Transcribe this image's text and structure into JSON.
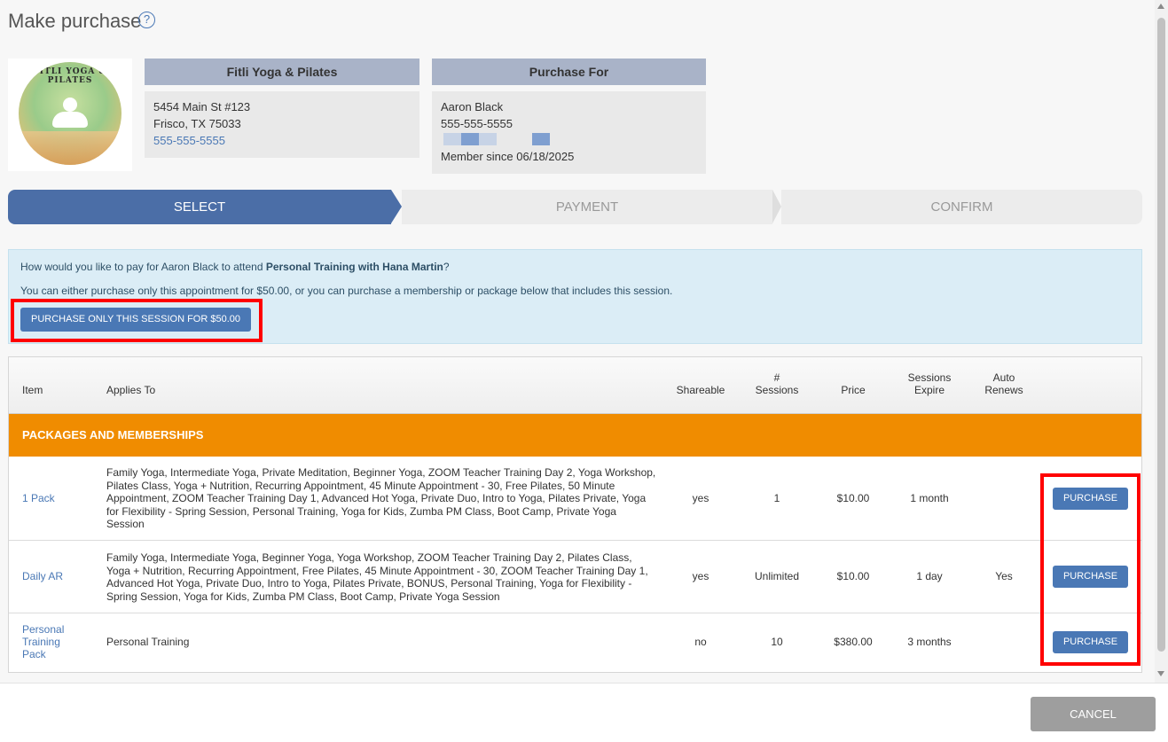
{
  "dialog": {
    "title": "Make purchase",
    "help_icon": "question-circle-icon"
  },
  "studio": {
    "name": "Fitli Yoga & Pilates",
    "logo_text": "FITLI YOGA & PILATES",
    "address_line1": "5454 Main St #123",
    "address_line2": "Frisco, TX 75033",
    "phone": "555-555-5555"
  },
  "purchase_for": {
    "heading": "Purchase For",
    "name": "Aaron Black",
    "phone": "555-555-5555",
    "member_since": "Member since 06/18/2025"
  },
  "steps": [
    "SELECT",
    "PAYMENT",
    "CONFIRM"
  ],
  "active_step": "SELECT",
  "info": {
    "line1_prefix": "How would you like to pay for Aaron Black to attend ",
    "line1_bold": "Personal Training with Hana Martin",
    "line1_suffix": "?",
    "line2": "You can either purchase only this appointment for $50.00, or you can purchase a membership or package below that includes this session.",
    "session_button": "PURCHASE ONLY THIS SESSION FOR $50.00"
  },
  "table": {
    "headers": {
      "item": "Item",
      "applies_to": "Applies To",
      "shareable": "Shareable",
      "sessions_1": "#",
      "sessions_2": "Sessions",
      "price": "Price",
      "expire_1": "Sessions",
      "expire_2": "Expire",
      "renew_1": "Auto",
      "renew_2": "Renews"
    },
    "section_title": "PACKAGES AND MEMBERSHIPS",
    "rows": [
      {
        "item": "1 Pack",
        "applies_to": "Family Yoga, Intermediate Yoga, Private Meditation, Beginner Yoga, ZOOM Teacher Training Day 2, Yoga Workshop, Pilates Class, Yoga + Nutrition, Recurring Appointment, 45 Minute Appointment - 30, Free Pilates, 50 Minute Appointment, ZOOM Teacher Training Day 1, Advanced Hot Yoga, Private Duo, Intro to Yoga, Pilates Private, Yoga for Flexibility - Spring Session, Personal Training, Yoga for Kids, Zumba PM Class, Boot Camp, Private Yoga Session",
        "shareable": "yes",
        "sessions": "1",
        "price": "$10.00",
        "expire": "1 month",
        "auto_renews": "",
        "button": "PURCHASE"
      },
      {
        "item": "Daily AR",
        "applies_to": "Family Yoga, Intermediate Yoga, Beginner Yoga, Yoga Workshop, ZOOM Teacher Training Day 2, Pilates Class, Yoga + Nutrition, Recurring Appointment, Free Pilates, 45 Minute Appointment - 30, ZOOM Teacher Training Day 1, Advanced Hot Yoga, Private Duo, Intro to Yoga, Pilates Private, BONUS, Personal Training, Yoga for Flexibility - Spring Session, Yoga for Kids, Zumba PM Class, Boot Camp, Private Yoga Session",
        "shareable": "yes",
        "sessions": "Unlimited",
        "price": "$10.00",
        "expire": "1 day",
        "auto_renews": "Yes",
        "button": "PURCHASE"
      },
      {
        "item": "Personal Training Pack",
        "applies_to": "Personal Training",
        "shareable": "no",
        "sessions": "10",
        "price": "$380.00",
        "expire": "3 months",
        "auto_renews": "",
        "button": "PURCHASE"
      }
    ]
  },
  "footer": {
    "cancel": "CANCEL"
  },
  "colors": {
    "accent": "#4a78b5",
    "step_active": "#4b6ea7",
    "section": "#f08c00",
    "highlight": "#ff0000",
    "info_bg": "#dbedf6"
  }
}
